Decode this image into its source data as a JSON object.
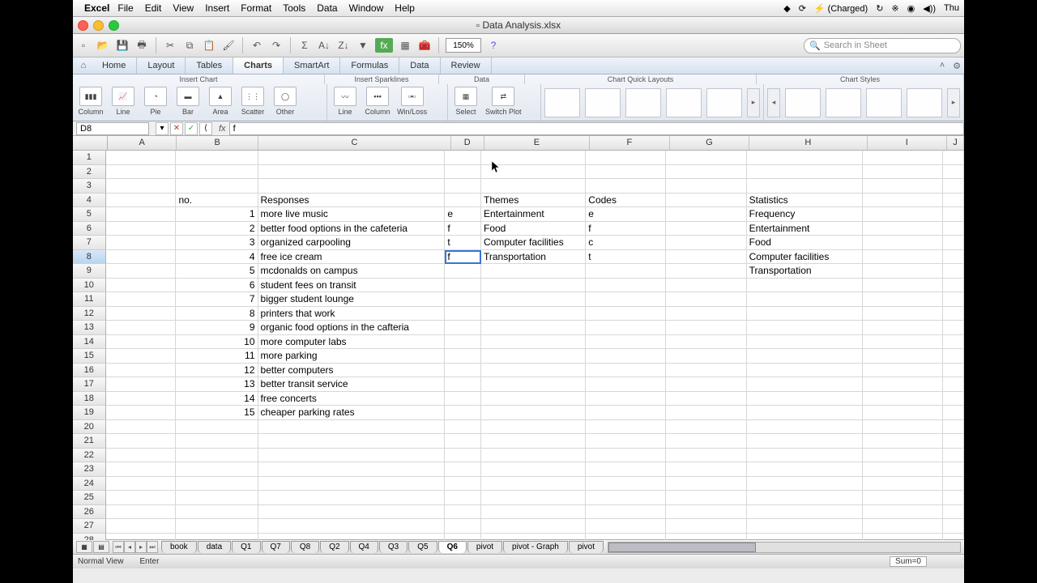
{
  "menubar": {
    "app": "Excel",
    "items": [
      "File",
      "Edit",
      "View",
      "Insert",
      "Format",
      "Tools",
      "Data",
      "Window",
      "Help"
    ],
    "battery": "⚡ (Charged)",
    "day": "Thu"
  },
  "window": {
    "title": "Data Analysis.xlsx"
  },
  "toolbar": {
    "zoom": "150%",
    "search_placeholder": "Search in Sheet"
  },
  "ribbon": {
    "tabs": [
      "Home",
      "Layout",
      "Tables",
      "Charts",
      "SmartArt",
      "Formulas",
      "Data",
      "Review"
    ],
    "active": "Charts",
    "groups": [
      "Insert Chart",
      "Insert Sparklines",
      "Data",
      "Chart Quick Layouts",
      "Chart Styles"
    ],
    "insert_chart": [
      "Column",
      "Line",
      "Pie",
      "Bar",
      "Area",
      "Scatter",
      "Other"
    ],
    "sparklines": [
      "Line",
      "Column",
      "Win/Loss"
    ],
    "data_group": [
      "Select",
      "Switch Plot"
    ]
  },
  "formula_bar": {
    "name": "D8",
    "value": "f"
  },
  "grid": {
    "columns": [
      "A",
      "B",
      "C",
      "D",
      "E",
      "F",
      "G",
      "H",
      "I",
      "J"
    ],
    "selected": {
      "row": 8,
      "col": "D"
    },
    "data": {
      "4": {
        "B": "no.",
        "C": "Responses",
        "E": "Themes",
        "F": "Codes",
        "H": "Statistics"
      },
      "5": {
        "B": "1",
        "C": "more live music",
        "D": "e",
        "E": "Entertainment",
        "F": "e",
        "H": "Frequency"
      },
      "6": {
        "B": "2",
        "C": "better food options in the cafeteria",
        "D": "f",
        "E": "Food",
        "F": "f",
        "H": "Entertainment"
      },
      "7": {
        "B": "3",
        "C": "organized carpooling",
        "D": "t",
        "E": "Computer facilities",
        "F": "c",
        "H": "Food"
      },
      "8": {
        "B": "4",
        "C": "free ice cream",
        "D": "f",
        "E": "Transportation",
        "F": "t",
        "H": "Computer facilities"
      },
      "9": {
        "B": "5",
        "C": "mcdonalds on campus",
        "H": "Transportation"
      },
      "10": {
        "B": "6",
        "C": "student fees on transit"
      },
      "11": {
        "B": "7",
        "C": "bigger student lounge"
      },
      "12": {
        "B": "8",
        "C": "printers that work"
      },
      "13": {
        "B": "9",
        "C": "organic food options in the cafteria"
      },
      "14": {
        "B": "10",
        "C": "more computer labs"
      },
      "15": {
        "B": "11",
        "C": "more parking"
      },
      "16": {
        "B": "12",
        "C": "better computers"
      },
      "17": {
        "B": "13",
        "C": "better transit service"
      },
      "18": {
        "B": "14",
        "C": "free concerts"
      },
      "19": {
        "B": "15",
        "C": "cheaper parking rates"
      }
    }
  },
  "sheets": {
    "tabs": [
      "book",
      "data",
      "Q1",
      "Q7",
      "Q8",
      "Q2",
      "Q4",
      "Q3",
      "Q5",
      "Q6",
      "pivot",
      "pivot - Graph",
      "pivot"
    ],
    "active": "Q6"
  },
  "status": {
    "view": "Normal View",
    "mode": "Enter",
    "sum": "Sum=0"
  }
}
